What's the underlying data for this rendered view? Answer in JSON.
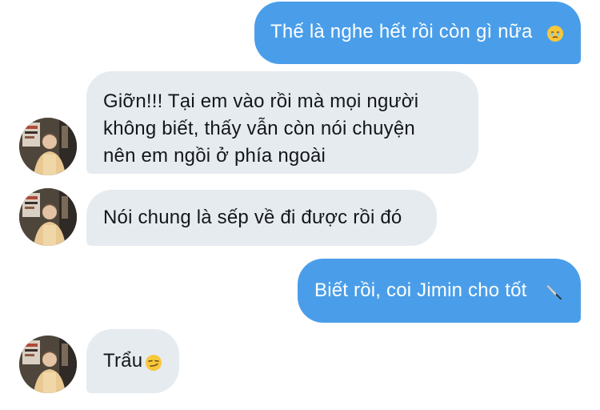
{
  "messages": [
    {
      "side": "sent",
      "lines": [
        "Thế là nghe hết rồi còn gì nữa"
      ],
      "emoji": "face-holding-back-tears-icon"
    },
    {
      "side": "received",
      "lines": [
        "Giỡn!!! Tại em vào rồi mà mọi người",
        "không biết, thấy vẫn còn nói chuyện",
        "nên em ngồi ở phía ngoài"
      ]
    },
    {
      "side": "received",
      "lines": [
        "Nói chung là sếp về đi được rồi đó"
      ]
    },
    {
      "side": "sent",
      "lines": [
        "Biết rồi, coi Jimin cho tốt"
      ],
      "emoji": "kitchen-knife-icon"
    },
    {
      "side": "received",
      "lines": [
        "Trẩu"
      ],
      "emoji": "smirking-face-icon"
    }
  ],
  "avatar": {
    "icon": "profile-photo"
  },
  "colors": {
    "sent_bubble": "#4a9ee9",
    "received_bubble": "#e6ebf0",
    "sent_text": "#ffffff",
    "received_text": "#14171a"
  }
}
